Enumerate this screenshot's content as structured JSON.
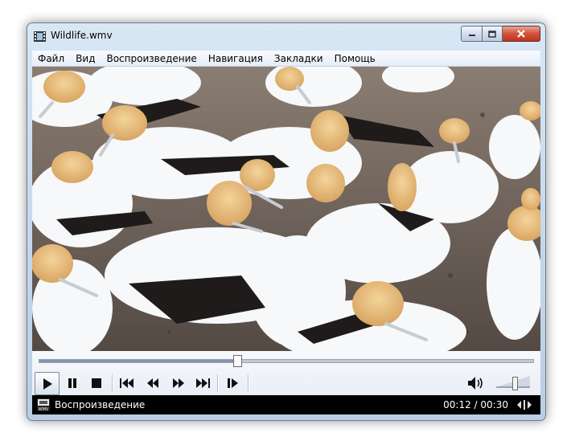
{
  "window": {
    "title": "Wildlife.wmv"
  },
  "menu": [
    "Файл",
    "Вид",
    "Воспроизведение",
    "Навигация",
    "Закладки",
    "Помощь"
  ],
  "video": {
    "subject": "gannets-colony"
  },
  "seek": {
    "position_fraction": 0.4
  },
  "controls": {
    "buttons": [
      "play-icon",
      "pause-icon",
      "stop-icon",
      "skip-previous-icon",
      "rewind-icon",
      "fast-forward-icon",
      "skip-next-icon",
      "frame-step-icon"
    ]
  },
  "volume": {
    "level_fraction": 0.55
  },
  "status": {
    "state": "Воспроизведение",
    "time": "00:12 / 00:30",
    "format_icon": "wmv-file-icon"
  },
  "colors": {
    "status_bg": "#000000",
    "close_button": "#c9432c",
    "frame": "#c3d6ea"
  }
}
